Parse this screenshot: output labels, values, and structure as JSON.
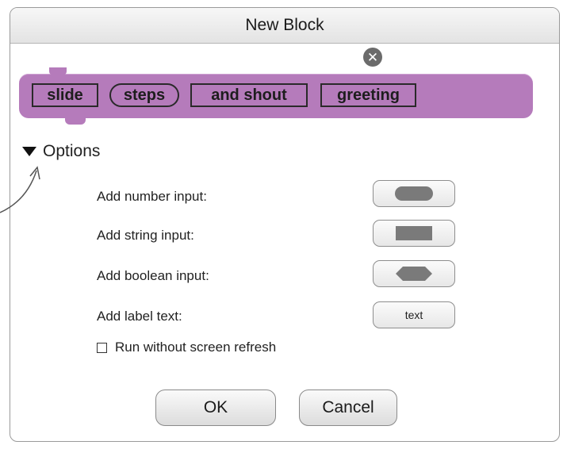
{
  "dialog": {
    "title": "New Block",
    "close_icon": "close-icon"
  },
  "block": {
    "color": "#b57bbb",
    "parts": [
      {
        "text": "slide",
        "kind": "label"
      },
      {
        "text": "steps",
        "kind": "number-input"
      },
      {
        "text": "and shout",
        "kind": "label"
      },
      {
        "text": "greeting",
        "kind": "label"
      }
    ]
  },
  "options": {
    "header": "Options",
    "rows": [
      {
        "label": "Add number input:",
        "button_icon": "number-input-shape-icon"
      },
      {
        "label": "Add string input:",
        "button_icon": "string-input-shape-icon"
      },
      {
        "label": "Add boolean input:",
        "button_icon": "boolean-input-shape-icon"
      },
      {
        "label": "Add label text:",
        "button_text": "text"
      }
    ],
    "checkbox": {
      "label": "Run without screen refresh",
      "checked": false
    }
  },
  "footer": {
    "ok_label": "OK",
    "cancel_label": "Cancel"
  }
}
